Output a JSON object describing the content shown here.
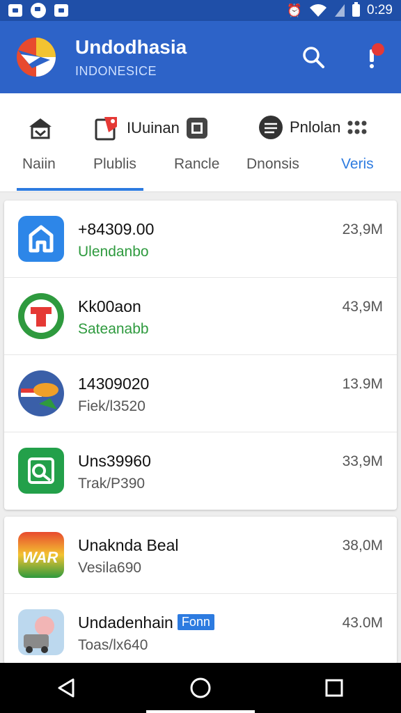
{
  "status_bar": {
    "time": "0:29"
  },
  "app_bar": {
    "title": "Undodhasia",
    "subtitle": "INDONESICE"
  },
  "tab_icons": [
    {
      "label": "",
      "icon": "home-icon"
    },
    {
      "label": "IUuinan",
      "icon": "tag-icon"
    },
    {
      "label": "Pnlolan",
      "icon": "chat-icon"
    }
  ],
  "tabs": [
    {
      "label": "Naiin"
    },
    {
      "label": "Plublis"
    },
    {
      "label": "Rancle"
    },
    {
      "label": "Dnonsis"
    },
    {
      "label": "Veris"
    }
  ],
  "list_group_1": [
    {
      "name": "+84309.00",
      "sub": "Ulendanbo",
      "size": "23,9M"
    },
    {
      "name": "Kk00aon",
      "sub": "Sateanabb",
      "size": "43,9M"
    },
    {
      "name": "14309020",
      "sub": "Fiek/l3520",
      "size": "13.9M"
    },
    {
      "name": "Uns39960",
      "sub": "Trak/P390",
      "size": "33,9M"
    }
  ],
  "list_group_2": [
    {
      "name": "Unaknda Beal",
      "sub": "Vesila690",
      "size": "38,0M",
      "badge": ""
    },
    {
      "name": "Undadenhain",
      "sub": "Toas/lx640",
      "size": "43.0M",
      "badge": "Fonn"
    }
  ],
  "colors": {
    "primary": "#2d63c8",
    "accent": "#2d7be0",
    "green": "#2e9a3e"
  }
}
